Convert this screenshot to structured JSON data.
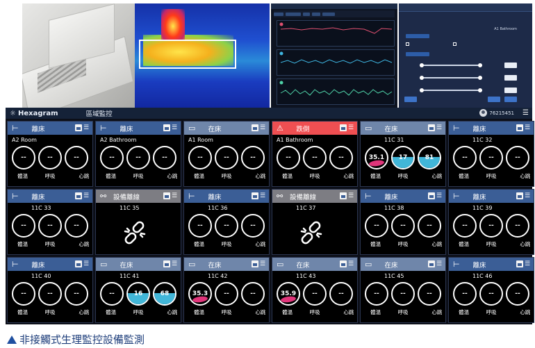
{
  "header": {
    "logo": "Hexagram",
    "page_title": "區域監控",
    "user_id": "76215451"
  },
  "labels": {
    "temp": "體溫",
    "resp": "呼吸",
    "heart": "心跳"
  },
  "cards": [
    {
      "status": "離床",
      "state": "off",
      "room": "A2 Room",
      "temp": "--",
      "resp": "--",
      "heart": "--"
    },
    {
      "status": "離床",
      "state": "off",
      "room": "A2 Bathroom",
      "temp": "--",
      "resp": "--",
      "heart": "--"
    },
    {
      "status": "在床",
      "state": "in",
      "room": "A1 Room",
      "temp": "--",
      "resp": "--",
      "heart": "--"
    },
    {
      "status": "跌倒",
      "state": "fall",
      "room": "A1 Bathroom",
      "temp": "--",
      "resp": "--",
      "heart": "--"
    },
    {
      "status": "在床",
      "state": "in",
      "room": "11C 31",
      "temp": "35.1",
      "resp": "17",
      "heart": "81"
    },
    {
      "status": "離床",
      "state": "off",
      "room": "11C 32",
      "temp": "--",
      "resp": "--",
      "heart": "--"
    },
    {
      "status": "離床",
      "state": "off",
      "room": "11C 33",
      "temp": "--",
      "resp": "--",
      "heart": "--"
    },
    {
      "status": "設備離線",
      "state": "disc",
      "room": "11C 35"
    },
    {
      "status": "離床",
      "state": "off",
      "room": "11C 36",
      "temp": "--",
      "resp": "--",
      "heart": "--"
    },
    {
      "status": "設備離線",
      "state": "disc",
      "room": "11C 37"
    },
    {
      "status": "離床",
      "state": "off",
      "room": "11C 38",
      "temp": "--",
      "resp": "--",
      "heart": "--"
    },
    {
      "status": "離床",
      "state": "off",
      "room": "11C 39",
      "temp": "--",
      "resp": "--",
      "heart": "--"
    },
    {
      "status": "離床",
      "state": "off",
      "room": "11C 40",
      "temp": "--",
      "resp": "--",
      "heart": "--"
    },
    {
      "status": "在床",
      "state": "in",
      "room": "11C 41",
      "temp": "--",
      "resp": "16",
      "heart": "68"
    },
    {
      "status": "在床",
      "state": "in",
      "room": "11C 42",
      "temp": "35.3",
      "resp": "--",
      "heart": "--"
    },
    {
      "status": "在床",
      "state": "in",
      "room": "11C 43",
      "temp": "35.9",
      "resp": "--",
      "heart": "--"
    },
    {
      "status": "在床",
      "state": "in",
      "room": "11C 45",
      "temp": "--",
      "resp": "--",
      "heart": "--"
    },
    {
      "status": "離床",
      "state": "off",
      "room": "11C 46",
      "temp": "--",
      "resp": "--",
      "heart": "--"
    }
  ],
  "settings_panel": {
    "subtitle": "A1 Bathroom"
  },
  "caption": "非接觸式生理監控設備監測",
  "icons": {
    "bed": "bed-icon",
    "fall": "fall-person-icon",
    "disconnect": "broken-link-icon",
    "menu": "hamburger-menu-icon"
  },
  "colors": {
    "off": "#3b5e96",
    "in": "#6f86aa",
    "fall": "#ef4f52",
    "disc": "#7d7d83",
    "temp_fill": "#e0357a",
    "vital_fill": "#41b6d8"
  }
}
